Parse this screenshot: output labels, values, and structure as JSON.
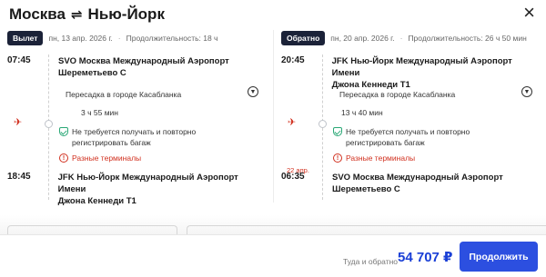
{
  "header": {
    "origin": "Москва",
    "swap_icon": "⇌",
    "destination": "Нью-Йорк",
    "close_icon": "×"
  },
  "outbound": {
    "badge": "Вылет",
    "date": "пн, 13 апр. 2026 г.",
    "duration_label": "Продолжительность: 18 ч",
    "dep_time": "07:45",
    "dep_airport_line1": "SVO Москва Международный Аэропорт",
    "dep_airport_line2": "Шереметьево C",
    "transfer": "Пересадка в городе Касабланка",
    "transfer_duration": "3 ч 55 мин",
    "baggage_line1": "Не требуется получать и повторно",
    "baggage_line2": "регистрировать багаж",
    "terminals": "Разные терминалы",
    "arr_time": "18:45",
    "arr_airport_line1": "JFK Нью-Йорк Международный Аэропорт Имени",
    "arr_airport_line2": "Джона Кеннеди T1"
  },
  "inbound": {
    "badge": "Обратно",
    "date": "пн, 20 апр. 2026 г.",
    "duration_label": "Продолжительность: 26 ч 50 мин",
    "dep_time": "20:45",
    "dep_airport_line1": "JFK Нью-Йорк Международный Аэропорт Имени",
    "dep_airport_line2": "Джона Кеннеди T1",
    "transfer": "Пересадка в городе Касабланка",
    "transfer_duration": "13 ч 40 мин",
    "baggage_line1": "Не требуется получать и повторно",
    "baggage_line2": "регистрировать багаж",
    "terminals": "Разные терминалы",
    "next_day": "22 апр.",
    "arr_time": "06:35",
    "arr_airport_line1": "SVO Москва Международный Аэропорт",
    "arr_airport_line2": "Шереметьево C"
  },
  "footer": {
    "price_label": "Туда и обратно",
    "price": "54 707 ₽",
    "continue_button": "Продолжить"
  },
  "colors": {
    "accent": "#2c4fe0",
    "price": "#1a3fd6",
    "warning": "#d1301f",
    "badge_bg": "#1b2238",
    "ok": "#2aa876"
  }
}
